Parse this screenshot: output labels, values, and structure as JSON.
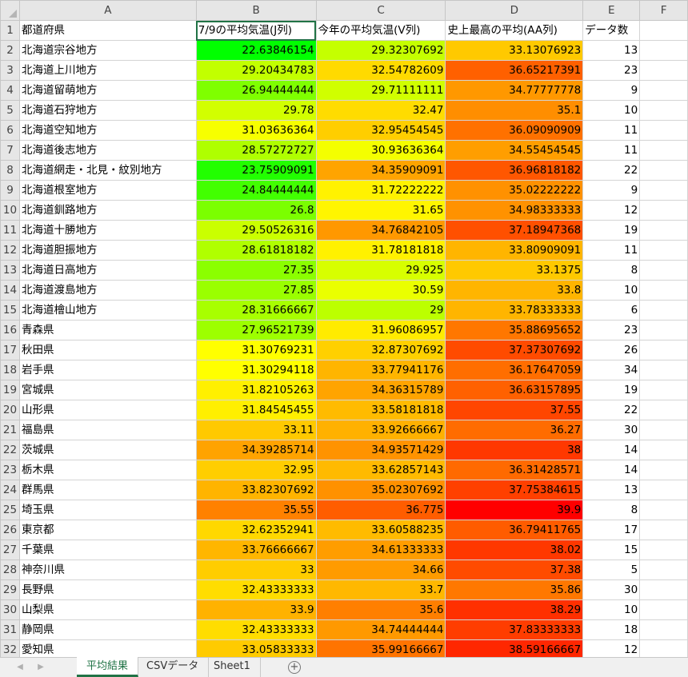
{
  "spreadsheet": {
    "column_headers": [
      "A",
      "B",
      "C",
      "D",
      "E",
      "F"
    ],
    "header_row": [
      "都道府県",
      "7/9の平均気温(J列)",
      "今年の平均気温(V列)",
      "史上最高の平均(AA列)",
      "データ数"
    ],
    "rows": [
      {
        "num": "1",
        "cells": [
          "都道府県",
          "7/9の平均気温(J列)",
          "今年の平均気温(V列)",
          "史上最高の平均(AA列)",
          "データ数",
          ""
        ]
      },
      {
        "num": "2",
        "cells": [
          "北海道宗谷地方",
          "22.63846154",
          "29.32307692",
          "33.13076923",
          "13",
          ""
        ]
      },
      {
        "num": "3",
        "cells": [
          "北海道上川地方",
          "29.20434783",
          "32.54782609",
          "36.65217391",
          "23",
          ""
        ]
      },
      {
        "num": "4",
        "cells": [
          "北海道留萌地方",
          "26.94444444",
          "29.71111111",
          "34.77777778",
          "9",
          ""
        ]
      },
      {
        "num": "5",
        "cells": [
          "北海道石狩地方",
          "29.78",
          "32.47",
          "35.1",
          "10",
          ""
        ]
      },
      {
        "num": "6",
        "cells": [
          "北海道空知地方",
          "31.03636364",
          "32.95454545",
          "36.09090909",
          "11",
          ""
        ]
      },
      {
        "num": "7",
        "cells": [
          "北海道後志地方",
          "28.57272727",
          "30.93636364",
          "34.55454545",
          "11",
          ""
        ]
      },
      {
        "num": "8",
        "cells": [
          "北海道網走・北見・紋別地方",
          "23.75909091",
          "34.35909091",
          "36.96818182",
          "22",
          ""
        ]
      },
      {
        "num": "9",
        "cells": [
          "北海道根室地方",
          "24.84444444",
          "31.72222222",
          "35.02222222",
          "9",
          ""
        ]
      },
      {
        "num": "10",
        "cells": [
          "北海道釧路地方",
          "26.8",
          "31.65",
          "34.98333333",
          "12",
          ""
        ]
      },
      {
        "num": "11",
        "cells": [
          "北海道十勝地方",
          "29.50526316",
          "34.76842105",
          "37.18947368",
          "19",
          ""
        ]
      },
      {
        "num": "12",
        "cells": [
          "北海道胆振地方",
          "28.61818182",
          "31.78181818",
          "33.80909091",
          "11",
          ""
        ]
      },
      {
        "num": "13",
        "cells": [
          "北海道日高地方",
          "27.35",
          "29.925",
          "33.1375",
          "8",
          ""
        ]
      },
      {
        "num": "14",
        "cells": [
          "北海道渡島地方",
          "27.85",
          "30.59",
          "33.8",
          "10",
          ""
        ]
      },
      {
        "num": "15",
        "cells": [
          "北海道檜山地方",
          "28.31666667",
          "29",
          "33.78333333",
          "6",
          ""
        ]
      },
      {
        "num": "16",
        "cells": [
          "青森県",
          "27.96521739",
          "31.96086957",
          "35.88695652",
          "23",
          ""
        ]
      },
      {
        "num": "17",
        "cells": [
          "秋田県",
          "31.30769231",
          "32.87307692",
          "37.37307692",
          "26",
          ""
        ]
      },
      {
        "num": "18",
        "cells": [
          "岩手県",
          "31.30294118",
          "33.77941176",
          "36.17647059",
          "34",
          ""
        ]
      },
      {
        "num": "19",
        "cells": [
          "宮城県",
          "31.82105263",
          "34.36315789",
          "36.63157895",
          "19",
          ""
        ]
      },
      {
        "num": "20",
        "cells": [
          "山形県",
          "31.84545455",
          "33.58181818",
          "37.55",
          "22",
          ""
        ]
      },
      {
        "num": "21",
        "cells": [
          "福島県",
          "33.11",
          "33.92666667",
          "36.27",
          "30",
          ""
        ]
      },
      {
        "num": "22",
        "cells": [
          "茨城県",
          "34.39285714",
          "34.93571429",
          "38",
          "14",
          ""
        ]
      },
      {
        "num": "23",
        "cells": [
          "栃木県",
          "32.95",
          "33.62857143",
          "36.31428571",
          "14",
          ""
        ]
      },
      {
        "num": "24",
        "cells": [
          "群馬県",
          "33.82307692",
          "35.02307692",
          "37.75384615",
          "13",
          ""
        ]
      },
      {
        "num": "25",
        "cells": [
          "埼玉県",
          "35.55",
          "36.775",
          "39.9",
          "8",
          ""
        ]
      },
      {
        "num": "26",
        "cells": [
          "東京都",
          "32.62352941",
          "33.60588235",
          "36.79411765",
          "17",
          ""
        ]
      },
      {
        "num": "27",
        "cells": [
          "千葉県",
          "33.76666667",
          "34.61333333",
          "38.02",
          "15",
          ""
        ]
      },
      {
        "num": "28",
        "cells": [
          "神奈川県",
          "33",
          "34.66",
          "37.38",
          "5",
          ""
        ]
      },
      {
        "num": "29",
        "cells": [
          "長野県",
          "32.43333333",
          "33.7",
          "35.86",
          "30",
          ""
        ]
      },
      {
        "num": "30",
        "cells": [
          "山梨県",
          "33.9",
          "35.6",
          "38.29",
          "10",
          ""
        ]
      },
      {
        "num": "31",
        "cells": [
          "静岡県",
          "32.43333333",
          "34.74444444",
          "37.83333333",
          "18",
          ""
        ]
      },
      {
        "num": "32",
        "cells": [
          "愛知県",
          "33.05833333",
          "35.99166667",
          "38.59166667",
          "12",
          ""
        ]
      }
    ],
    "color_scale": {
      "type": "3-color",
      "min_color": "#00ff00",
      "mid_color": "#ffff00",
      "max_color": "#ff0000",
      "min_value": 22.6,
      "mid_value": 31.3,
      "max_value": 39.9,
      "applied_columns": [
        "B",
        "C",
        "D"
      ]
    },
    "active_cell": "B1"
  },
  "sheet_tabs": [
    {
      "label": "平均結果",
      "active": true
    },
    {
      "label": "CSVデータ",
      "active": false
    },
    {
      "label": "Sheet1",
      "active": false
    }
  ],
  "icons": {
    "prev_sheet": "caret-left-icon",
    "next_sheet": "caret-right-icon",
    "add_sheet": "plus-circle-icon"
  }
}
